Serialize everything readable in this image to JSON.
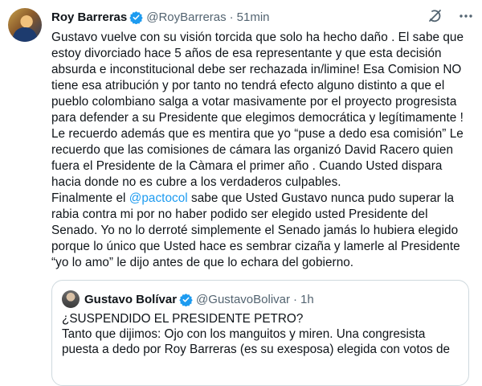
{
  "author": {
    "name": "Roy Barreras",
    "handle": "@RoyBarreras",
    "separator": "·",
    "time": "51min"
  },
  "icons": {
    "verified": "verified-badge-icon",
    "grok": "grok-icon",
    "more": "more-options-icon",
    "accent": "#1d9bf0"
  },
  "tweet": {
    "lines": [
      "Gustavo vuelve con su visión torcida que solo ha hecho daño . El sabe que",
      "estoy divorciado hace 5 años de esa representante y que esta decisión",
      "absurda e inconstitucional debe ser rechazada in/limine! Esa Comision NO",
      "tiene esa atribución y por tanto no tendrá efecto alguno distinto a que el",
      "pueblo colombiano salga a votar masivamente por el proyecto progresista",
      "para  defender a su Presidente que elegimos democrática y legítimamente !",
      "Le recuerdo además que es mentira que yo “puse a dedo esa comisión” Le",
      "recuerdo que las comisiones de cámara las organizó David Racero quien",
      "fuera el Presidente de la Càmara el primer año . Cuando Usted dispara",
      "hacia donde no es cubre a los verdaderos culpables."
    ],
    "final_before": "Finalmente el ",
    "final_mention": "@pactocol",
    "final_after": " sabe que Usted Gustavo nunca pudo superar la",
    "lines2": [
      "rabia contra mi por no haber podido ser elegido usted Presidente del",
      "Senado. Yo no lo derroté simplemente el Senado jamás lo hubiera elegido",
      "porque lo único que Usted  hace es sembrar cizaña y lamerle al Presidente",
      "“yo lo amo” le dijo antes de que lo echara del gobierno."
    ]
  },
  "quote": {
    "name": "Gustavo Bolívar",
    "handle": "@GustavoBolivar",
    "separator": "·",
    "time": "1h",
    "lines": [
      "¿SUSPENDIDO EL PRESIDENTE PETRO?",
      "Tanto que dijimos: Ojo con los manguitos y miren. Una congresista",
      "puesta a dedo por Roy Barreras (es su exesposa) elegida con votos de"
    ]
  }
}
